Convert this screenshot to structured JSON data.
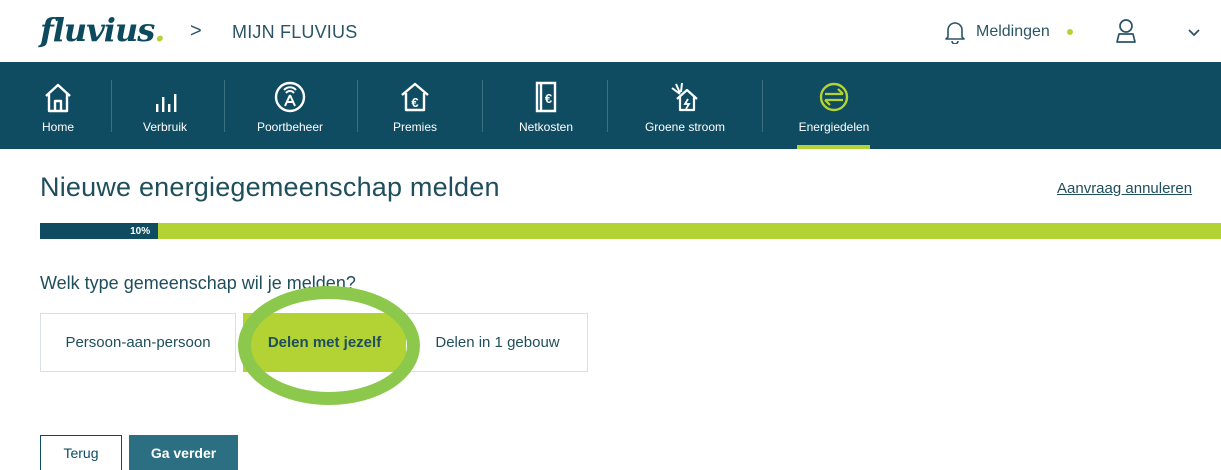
{
  "header": {
    "logo_text": "fluvius",
    "logo_dot": ".",
    "breadcrumb_separator": ">",
    "breadcrumb": "MIJN FLUVIUS",
    "notifications_label": "Meldingen",
    "icons": [
      "bell-icon",
      "status-dot",
      "user-icon",
      "chevron-down-icon"
    ]
  },
  "nav": {
    "items": [
      {
        "label": "Home",
        "icon": "home-icon"
      },
      {
        "label": "Verbruik",
        "icon": "usage-bars-icon"
      },
      {
        "label": "Poortbeheer",
        "icon": "meter-port-icon"
      },
      {
        "label": "Premies",
        "icon": "euro-house-icon"
      },
      {
        "label": "Netkosten",
        "icon": "euro-document-icon"
      },
      {
        "label": "Groene stroom",
        "icon": "solar-house-icon"
      },
      {
        "label": "Energiedelen",
        "icon": "energy-sharing-icon"
      }
    ],
    "active": "Energiedelen"
  },
  "main": {
    "title": "Nieuwe energiegemeenschap melden",
    "cancel_link": "Aanvraag annuleren",
    "progress": {
      "label": "10%",
      "value": 0.1
    },
    "question": "Welk type gemeenschap wil je melden?",
    "options": [
      {
        "label": "Persoon-aan-persoon",
        "selected": false
      },
      {
        "label": "Delen met jezelf",
        "selected": true
      },
      {
        "label": "Delen in 1 gebouw",
        "selected": false
      }
    ],
    "back_button": "Terug",
    "next_button": "Ga verder"
  },
  "colors": {
    "primary": "#0f4c62",
    "accent": "#b3d334",
    "highlight_ring": "#8cc84b",
    "text": "#1f4e5c"
  }
}
